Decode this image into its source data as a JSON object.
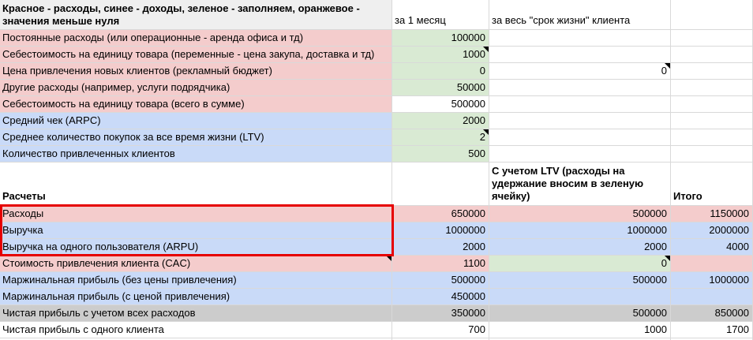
{
  "palette": {
    "expense_red": "#f4cccc",
    "income_blue": "#c9daf8",
    "fill_green": "#d9ead3",
    "total_gray": "#cccccc",
    "legend_gray": "#efefef",
    "highlight_border": "#e60000",
    "gridline": "#d9d9d9",
    "note_marker": "#000000"
  },
  "highlight": {
    "color": "#e60000",
    "around_rows": [
      "Расходы",
      "Выручка",
      "Выручка на одного пользователя (ARPU)"
    ],
    "column": "labels"
  },
  "sheet": {
    "rows": [
      {
        "kind": "head",
        "cells": [
          {
            "t": "Красное - расходы, синее - доходы, зеленое - заполняем, оранжевое - значения меньше нуля",
            "bg": "legend",
            "b": 1,
            "a": "l",
            "va": "t",
            "wrap": 1
          },
          {
            "t": "за 1 месяц",
            "bg": "white",
            "a": "l",
            "va": "b"
          },
          {
            "t": "за весь \"срок жизни\" клиента",
            "bg": "white",
            "a": "l",
            "va": "b"
          },
          {
            "t": "",
            "bg": "white"
          }
        ]
      },
      {
        "kind": "normal",
        "cells": [
          {
            "t": "Постоянные расходы (или операционные - аренда офиса и тд)",
            "bg": "red",
            "a": "l"
          },
          {
            "t": "100000",
            "bg": "green",
            "a": "r"
          },
          {
            "t": "",
            "bg": "white"
          },
          {
            "t": "",
            "bg": "white"
          }
        ]
      },
      {
        "kind": "normal",
        "cells": [
          {
            "t": "Себестоимость на единицу товара (переменные - цена закупа, доставка и тд)",
            "bg": "red",
            "a": "l"
          },
          {
            "t": "1000",
            "bg": "green",
            "a": "r",
            "note": 1
          },
          {
            "t": "",
            "bg": "white"
          },
          {
            "t": "",
            "bg": "white"
          }
        ]
      },
      {
        "kind": "normal",
        "cells": [
          {
            "t": "Цена привлечения новых клиентов (рекламный бюджет)",
            "bg": "red",
            "a": "l"
          },
          {
            "t": "0",
            "bg": "green",
            "a": "r"
          },
          {
            "t": "0",
            "bg": "white",
            "a": "r",
            "note": 1
          },
          {
            "t": "",
            "bg": "white"
          }
        ]
      },
      {
        "kind": "normal",
        "cells": [
          {
            "t": "Другие расходы (например, услуги подрядчика)",
            "bg": "red",
            "a": "l"
          },
          {
            "t": "50000",
            "bg": "green",
            "a": "r"
          },
          {
            "t": "",
            "bg": "white"
          },
          {
            "t": "",
            "bg": "white"
          }
        ]
      },
      {
        "kind": "normal",
        "cells": [
          {
            "t": "Себестоимость на единицу товара (всего в сумме)",
            "bg": "red",
            "a": "l"
          },
          {
            "t": "500000",
            "bg": "white",
            "a": "r"
          },
          {
            "t": "",
            "bg": "white"
          },
          {
            "t": "",
            "bg": "white"
          }
        ]
      },
      {
        "kind": "normal",
        "cells": [
          {
            "t": "Средний чек (ARPC)",
            "bg": "blue",
            "a": "l"
          },
          {
            "t": "2000",
            "bg": "green",
            "a": "r"
          },
          {
            "t": "",
            "bg": "white"
          },
          {
            "t": "",
            "bg": "white"
          }
        ]
      },
      {
        "kind": "normal",
        "cells": [
          {
            "t": "Среднее количество покупок за все время жизни (LTV)",
            "bg": "blue",
            "a": "l"
          },
          {
            "t": "2",
            "bg": "green",
            "a": "r",
            "note": 1
          },
          {
            "t": "",
            "bg": "white"
          },
          {
            "t": "",
            "bg": "white"
          }
        ]
      },
      {
        "kind": "normal",
        "cells": [
          {
            "t": "Количество привлеченных клиентов",
            "bg": "blue",
            "a": "l"
          },
          {
            "t": "500",
            "bg": "green",
            "a": "r"
          },
          {
            "t": "",
            "bg": "white"
          },
          {
            "t": "",
            "bg": "white"
          }
        ]
      },
      {
        "kind": "band",
        "cells": [
          {
            "t": "Расчеты",
            "bg": "white",
            "b": 1,
            "a": "l",
            "va": "b"
          },
          {
            "t": "",
            "bg": "white"
          },
          {
            "t": "С учетом LTV (расходы на удержание вносим в зеленую ячейку)",
            "bg": "white",
            "b": 1,
            "a": "l",
            "va": "b",
            "wrap": 1
          },
          {
            "t": "Итого",
            "bg": "white",
            "b": 1,
            "a": "l",
            "va": "b"
          }
        ]
      },
      {
        "kind": "normal",
        "cells": [
          {
            "t": "Расходы",
            "bg": "red",
            "a": "l"
          },
          {
            "t": "650000",
            "bg": "red",
            "a": "r"
          },
          {
            "t": "500000",
            "bg": "red",
            "a": "r"
          },
          {
            "t": "1150000",
            "bg": "red",
            "a": "r"
          }
        ]
      },
      {
        "kind": "normal",
        "cells": [
          {
            "t": "Выручка",
            "bg": "blue",
            "a": "l"
          },
          {
            "t": "1000000",
            "bg": "blue",
            "a": "r"
          },
          {
            "t": "1000000",
            "bg": "blue",
            "a": "r"
          },
          {
            "t": "2000000",
            "bg": "blue",
            "a": "r"
          }
        ]
      },
      {
        "kind": "normal",
        "cells": [
          {
            "t": "Выручка на одного пользователя (ARPU)",
            "bg": "blue",
            "a": "l"
          },
          {
            "t": "2000",
            "bg": "blue",
            "a": "r"
          },
          {
            "t": "2000",
            "bg": "blue",
            "a": "r"
          },
          {
            "t": "4000",
            "bg": "blue",
            "a": "r"
          }
        ]
      },
      {
        "kind": "normal",
        "cells": [
          {
            "t": "Стоимость привлечения клиента (CAC)",
            "bg": "red",
            "a": "l",
            "note": 1
          },
          {
            "t": "1100",
            "bg": "red",
            "a": "r"
          },
          {
            "t": "0",
            "bg": "green",
            "a": "r",
            "note": 1
          },
          {
            "t": "",
            "bg": "red"
          }
        ]
      },
      {
        "kind": "normal",
        "cells": [
          {
            "t": "Маржинальная прибыль (без цены привлечения)",
            "bg": "blue",
            "a": "l"
          },
          {
            "t": "500000",
            "bg": "blue",
            "a": "r"
          },
          {
            "t": "500000",
            "bg": "blue",
            "a": "r"
          },
          {
            "t": "1000000",
            "bg": "blue",
            "a": "r"
          }
        ]
      },
      {
        "kind": "normal",
        "cells": [
          {
            "t": "Маржинальная прибыль (с ценой привлечения)",
            "bg": "blue",
            "a": "l"
          },
          {
            "t": "450000",
            "bg": "blue",
            "a": "r"
          },
          {
            "t": "",
            "bg": "blue"
          },
          {
            "t": "",
            "bg": "blue"
          }
        ]
      },
      {
        "kind": "normal",
        "cells": [
          {
            "t": "Чистая прибыль с учетом всех расходов",
            "bg": "gray",
            "a": "l"
          },
          {
            "t": "350000",
            "bg": "gray",
            "a": "r"
          },
          {
            "t": "500000",
            "bg": "gray",
            "a": "r"
          },
          {
            "t": "850000",
            "bg": "gray",
            "a": "r"
          }
        ]
      },
      {
        "kind": "normal",
        "cells": [
          {
            "t": "Чистая прибыль с одного клиента",
            "bg": "white",
            "a": "l"
          },
          {
            "t": "700",
            "bg": "white",
            "a": "r"
          },
          {
            "t": "1000",
            "bg": "white",
            "a": "r"
          },
          {
            "t": "1700",
            "bg": "white",
            "a": "r"
          }
        ]
      },
      {
        "kind": "spacer",
        "cells": [
          {
            "t": "",
            "bg": "white"
          },
          {
            "t": "",
            "bg": "white"
          },
          {
            "t": "",
            "bg": "white"
          },
          {
            "t": "",
            "bg": "white"
          }
        ]
      }
    ]
  }
}
